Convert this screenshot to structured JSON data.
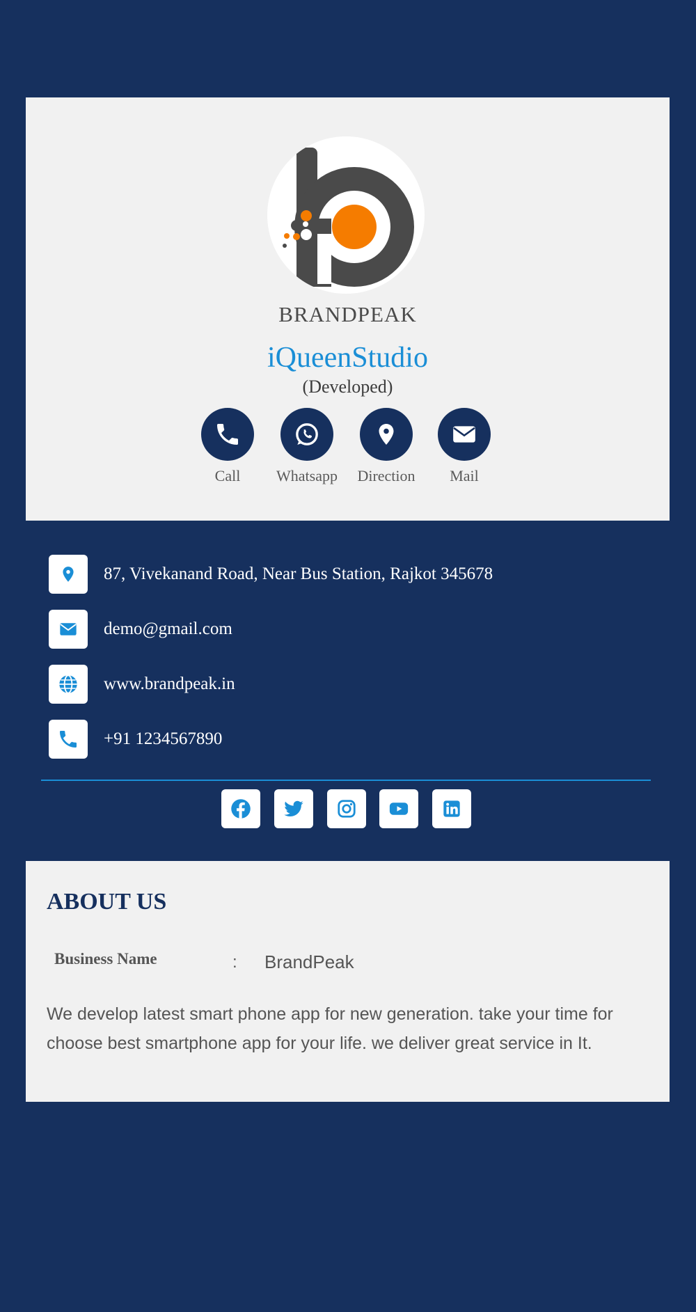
{
  "colors": {
    "background": "#16305e",
    "card": "#f1f1f1",
    "accent_blue": "#1a8ed6",
    "logo_orange": "#f57c00",
    "logo_gray": "#4a4a4a"
  },
  "profile": {
    "logo_icon": "brandpeak-logo",
    "brand_wordmark": "BRANDPEAK",
    "title": "iQueenStudio",
    "subtitle": "(Developed)"
  },
  "actions": [
    {
      "label": "Call",
      "icon": "phone-icon"
    },
    {
      "label": "Whatsapp",
      "icon": "whatsapp-icon"
    },
    {
      "label": "Direction",
      "icon": "map-pin-icon"
    },
    {
      "label": "Mail",
      "icon": "envelope-icon"
    }
  ],
  "contacts": {
    "address": "87, Vivekanand Road, Near Bus Station, Rajkot 345678",
    "email": "demo@gmail.com",
    "website": "www.brandpeak.in",
    "phone": "+91 1234567890"
  },
  "social": [
    "facebook-icon",
    "twitter-icon",
    "instagram-icon",
    "youtube-icon",
    "linkedin-icon"
  ],
  "about": {
    "heading": "ABOUT US",
    "business_name_label": "Business Name",
    "separator": ":",
    "business_name_value": "BrandPeak",
    "description": "We develop latest smart phone app for new generation. take your time for choose best smartphone app for your life. we deliver great service in It."
  }
}
